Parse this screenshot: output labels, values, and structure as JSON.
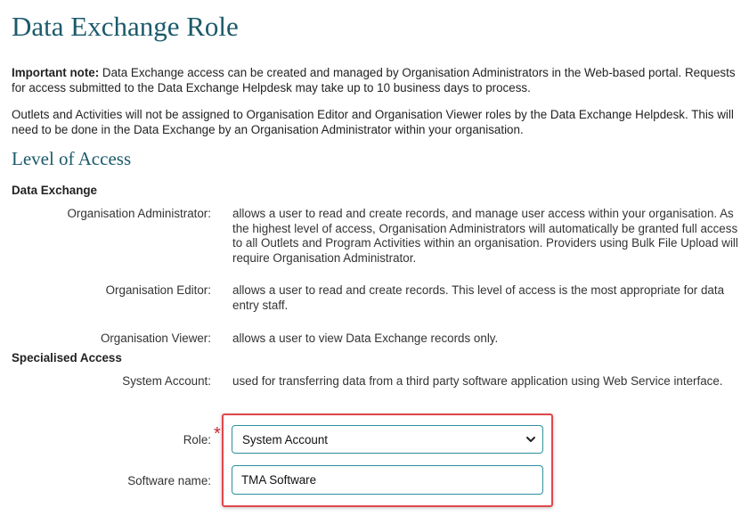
{
  "page": {
    "title": "Data Exchange Role"
  },
  "notes": {
    "important_label": "Important note:",
    "important_text": " Data Exchange access can be created and managed by Organisation Administrators in the Web-based portal. Requests for access submitted to the Data Exchange Helpdesk may take up to 10 business days to process.",
    "outlets_text": "Outlets and Activities will not be assigned to Organisation Editor and Organisation Viewer roles by the Data Exchange Helpdesk. This will need to be done in the Data Exchange by an Organisation Administrator within your organisation."
  },
  "level_of_access": {
    "title": "Level of Access",
    "data_exchange": {
      "heading": "Data Exchange",
      "roles": [
        {
          "label": "Organisation Administrator:",
          "description": "allows a user to read and create records, and manage user access within your organisation. As the highest level of access, Organisation Administrators will automatically be granted full access to all Outlets and Program Activities within an organisation. Providers using Bulk File Upload will require Organisation Administrator."
        },
        {
          "label": "Organisation Editor:",
          "description": "allows a user to read and create records. This level of access is the most appropriate for data entry staff."
        },
        {
          "label": "Organisation Viewer:",
          "description": "allows a user to view Data Exchange records only."
        }
      ]
    },
    "specialised": {
      "heading": "Specialised Access",
      "roles": [
        {
          "label": "System Account:",
          "description": "used for transferring data from a third party software application using Web Service interface."
        }
      ]
    }
  },
  "form": {
    "role_label": "Role:",
    "required_mark": "*",
    "role_selected": "System Account",
    "software_label": "Software name:",
    "software_value": "TMA Software"
  },
  "colors": {
    "heading": "#1b5a6b",
    "field_border": "#2d8fa0",
    "highlight_border": "#e0474c",
    "required": "#c0262d"
  }
}
